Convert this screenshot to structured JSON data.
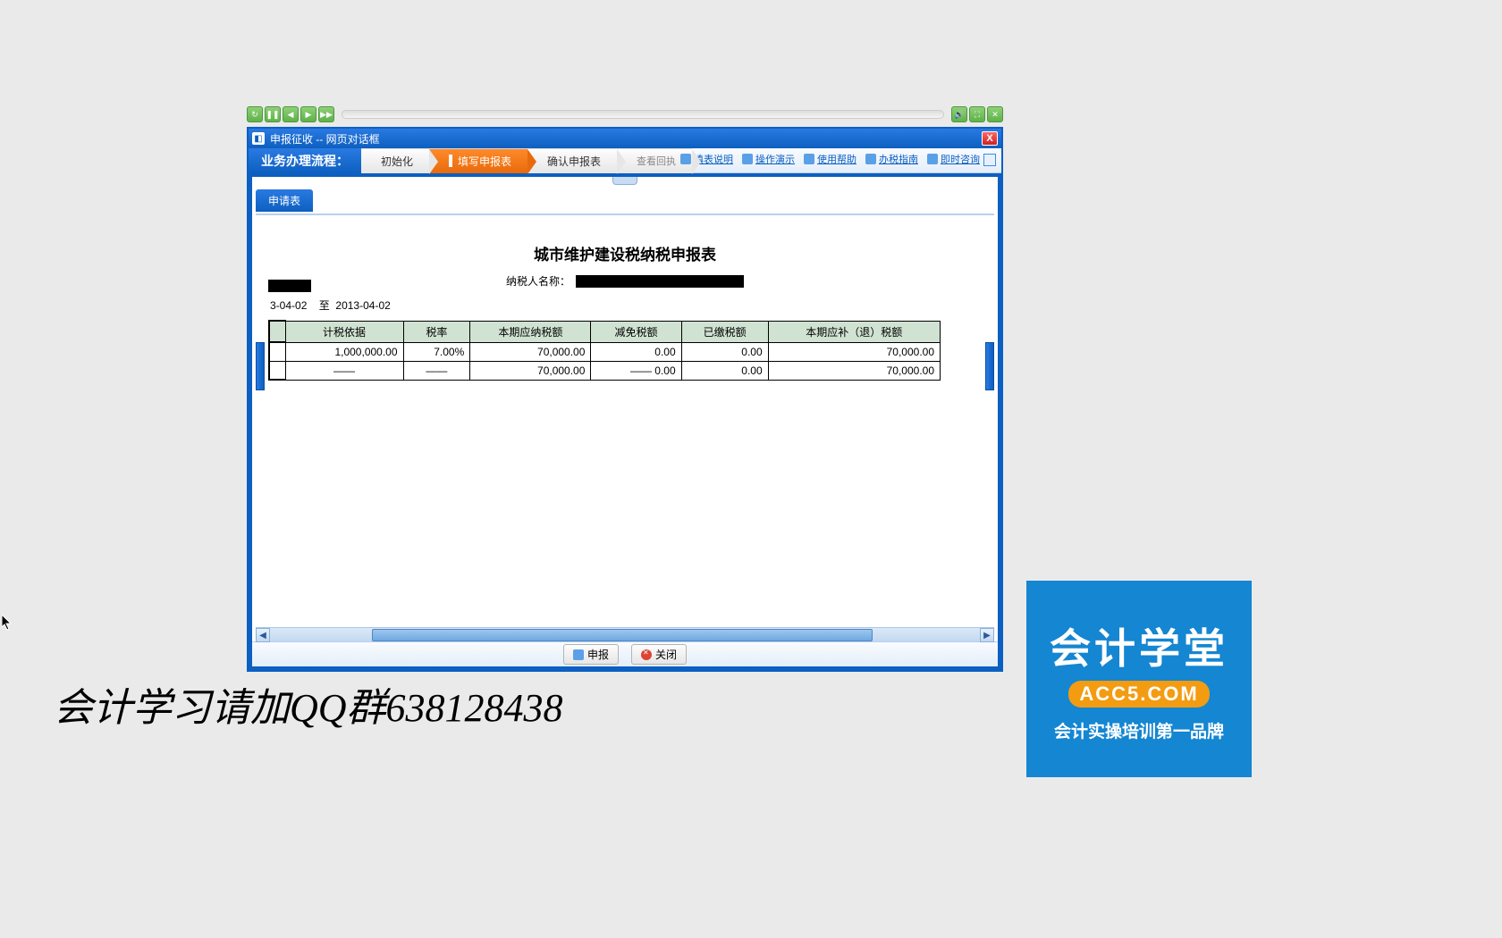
{
  "player": {
    "buttons": {
      "restart": "↻",
      "pause": "❚❚",
      "prev": "◀",
      "next": "▶",
      "ff": "▶▶",
      "volume": "🔊",
      "maximize": "⛶",
      "close": "✕"
    }
  },
  "dialog": {
    "title": "申报征收 -- 网页对话框",
    "flow_label": "业务办理流程：",
    "steps": {
      "init": "初始化",
      "fill": "填写申报表",
      "confirm": "确认申报表",
      "review": "查看回执"
    },
    "active_marker": "▮"
  },
  "help": {
    "l1": "填表说明",
    "l2": "操作演示",
    "l3": "使用帮助",
    "l4": "办税指南",
    "l5": "即时咨询"
  },
  "tab": {
    "label": "申请表"
  },
  "form": {
    "title": "城市维护建设税纳税申报表",
    "payer_label": "纳税人名称：",
    "period_prefix": "3-04-02",
    "period_to": "至",
    "period_end": "2013-04-02"
  },
  "table": {
    "headers": {
      "c1": "计税依据",
      "c2": "税率",
      "c3": "本期应纳税额",
      "c4": "减免税额",
      "c5": "已缴税额",
      "c6": "本期应补（退）税额"
    },
    "rows": [
      {
        "c1": "1,000,000.00",
        "c2": "7.00%",
        "c3": "70,000.00",
        "c4": "0.00",
        "c5": "0.00",
        "c6": "70,000.00"
      },
      {
        "c1": "——",
        "c2": "——",
        "c3": "70,000.00",
        "c4": "—— 0.00",
        "c5": "0.00",
        "c6": "70,000.00"
      }
    ]
  },
  "footer": {
    "submit": "申报",
    "close": "关闭"
  },
  "caption": "会计学习请加QQ群638128438",
  "brand": {
    "line1": "会计学堂",
    "line2": "ACC5.COM",
    "line3": "会计实操培训第一品牌"
  }
}
